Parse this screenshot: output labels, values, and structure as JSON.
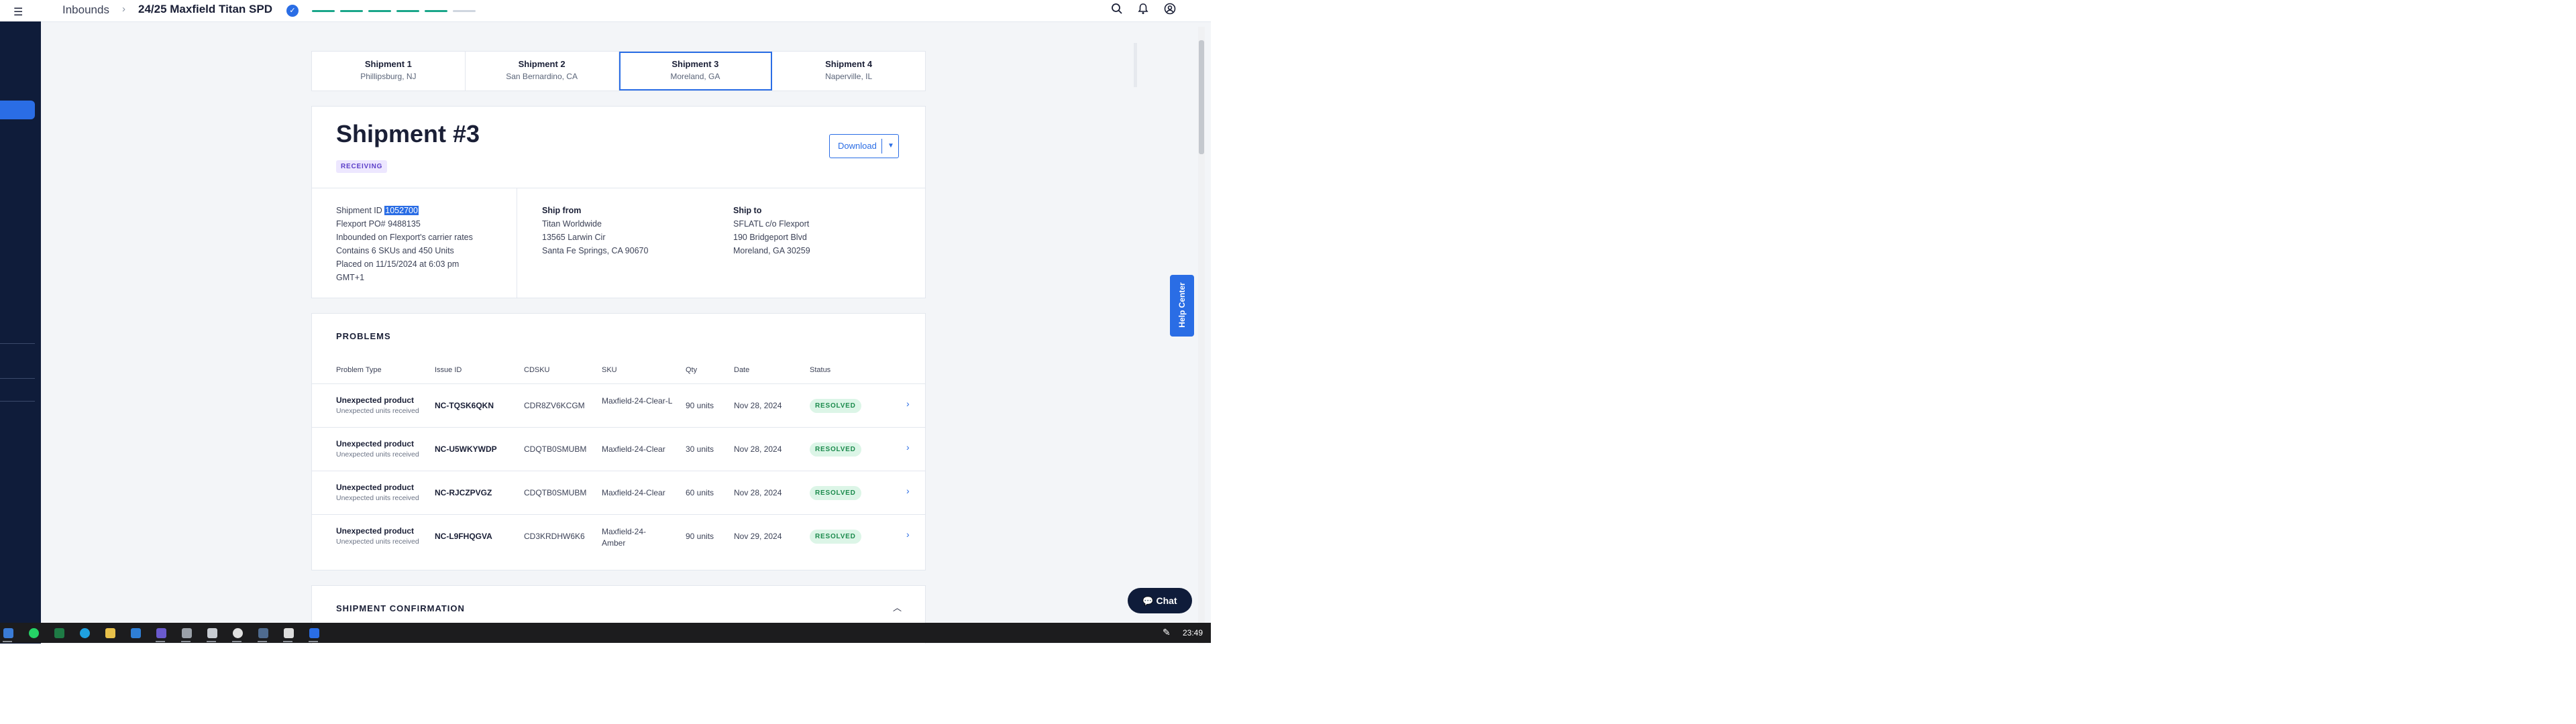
{
  "header": {
    "breadcrumb_root": "Inbounds",
    "separator": "›",
    "title": "24/25 Maxfield Titan SPD",
    "progress_steps_total": 6,
    "progress_steps_done": 5,
    "colors": {
      "progress_done": "#1aa68a",
      "accent": "#2a6de5",
      "sidebar": "#0f1c3a"
    }
  },
  "tabs": [
    {
      "label": "Shipment 1",
      "location": "Phillipsburg, NJ",
      "active": false
    },
    {
      "label": "Shipment 2",
      "location": "San Bernardino, CA",
      "active": false
    },
    {
      "label": "Shipment 3",
      "location": "Moreland, GA",
      "active": true
    },
    {
      "label": "Shipment 4",
      "location": "Naperville, IL",
      "active": false
    }
  ],
  "summary": {
    "title": "Shipment #3",
    "status": "RECEIVING",
    "download_label": "Download",
    "shipment_id_label": "Shipment ID",
    "shipment_id": "1052700",
    "po": "Flexport PO# 9488135",
    "rates": "Inbounded on Flexport's carrier rates",
    "contents": "Contains 6 SKUs and 450 Units",
    "placed": "Placed on 11/15/2024 at 6:03 pm",
    "tz": "GMT+1",
    "ship_from": {
      "label": "Ship from",
      "name": "Titan Worldwide",
      "street": "13565 Larwin Cir",
      "city": "Santa Fe Springs, CA 90670"
    },
    "ship_to": {
      "label": "Ship to",
      "name": "SFLATL c/o Flexport",
      "street": "190 Bridgeport Blvd",
      "city": "Moreland, GA 30259"
    }
  },
  "problems": {
    "title": "PROBLEMS",
    "columns": [
      "Problem Type",
      "Issue ID",
      "CDSKU",
      "SKU",
      "Qty",
      "Date",
      "Status"
    ],
    "rows": [
      {
        "type": "Unexpected product",
        "sub": "Unexpected units received",
        "issue": "NC-TQSK6QKN",
        "cdsku": "CDR8ZV6KCGM",
        "sku": "Maxfield-24-Clear-L",
        "qty": "90 units",
        "date": "Nov 28, 2024",
        "status": "RESOLVED"
      },
      {
        "type": "Unexpected product",
        "sub": "Unexpected units received",
        "issue": "NC-U5WKYWDP",
        "cdsku": "CDQTB0SMUBM",
        "sku": "Maxfield-24-Clear",
        "qty": "30 units",
        "date": "Nov 28, 2024",
        "status": "RESOLVED"
      },
      {
        "type": "Unexpected product",
        "sub": "Unexpected units received",
        "issue": "NC-RJCZPVGZ",
        "cdsku": "CDQTB0SMUBM",
        "sku": "Maxfield-24-Clear",
        "qty": "60 units",
        "date": "Nov 28, 2024",
        "status": "RESOLVED"
      },
      {
        "type": "Unexpected product",
        "sub": "Unexpected units received",
        "issue": "NC-L9FHQGVA",
        "cdsku": "CD3KRDHW6K6",
        "sku": "Maxfield-24-Amber",
        "qty": "90 units",
        "date": "Nov 29, 2024",
        "status": "RESOLVED"
      }
    ]
  },
  "confirmation": {
    "title": "SHIPMENT CONFIRMATION"
  },
  "help_center": "Help Center",
  "chat": "Chat",
  "taskbar": {
    "time": "23:49"
  }
}
